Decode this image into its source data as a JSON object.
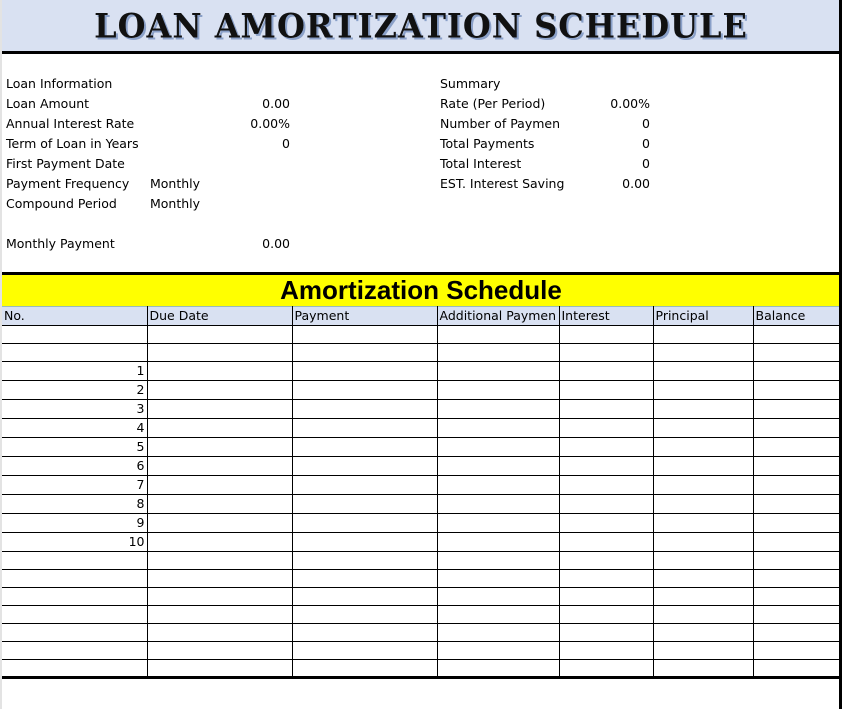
{
  "title": "LOAN AMORTIZATION SCHEDULE",
  "loan_information": {
    "heading": "Loan Information",
    "fields": [
      {
        "label": "Loan Amount",
        "value": "0.00",
        "align": "right"
      },
      {
        "label": "Annual Interest Rate",
        "value": "0.00%",
        "align": "right"
      },
      {
        "label": "Term of Loan in Years",
        "value": "0",
        "align": "right"
      },
      {
        "label": "First Payment Date",
        "value": "",
        "align": "right"
      },
      {
        "label": "Payment Frequency",
        "value": "Monthly",
        "align": "left"
      },
      {
        "label": "Compound Period",
        "value": "Monthly",
        "align": "left"
      }
    ],
    "monthly_payment": {
      "label": "Monthly Payment",
      "value": "0.00"
    }
  },
  "summary": {
    "heading": "Summary",
    "fields": [
      {
        "label": "Rate (Per Period)",
        "value": "0.00%"
      },
      {
        "label": "Number of Paymen",
        "value": "0"
      },
      {
        "label": "Total Payments",
        "value": "0"
      },
      {
        "label": "Total Interest",
        "value": "0"
      },
      {
        "label": "EST. Interest Saving",
        "value": "0.00"
      }
    ]
  },
  "schedule": {
    "title": "Amortization Schedule",
    "columns": [
      "No.",
      "Due Date",
      "Payment",
      "Additional Paymen",
      "Interest",
      "Principal",
      "Balance"
    ],
    "rows": [
      [
        "",
        "",
        "",
        "",
        "",
        "",
        ""
      ],
      [
        "",
        "",
        "",
        "",
        "",
        "",
        ""
      ],
      [
        "1",
        "",
        "",
        "",
        "",
        "",
        ""
      ],
      [
        "2",
        "",
        "",
        "",
        "",
        "",
        ""
      ],
      [
        "3",
        "",
        "",
        "",
        "",
        "",
        ""
      ],
      [
        "4",
        "",
        "",
        "",
        "",
        "",
        ""
      ],
      [
        "5",
        "",
        "",
        "",
        "",
        "",
        ""
      ],
      [
        "6",
        "",
        "",
        "",
        "",
        "",
        ""
      ],
      [
        "7",
        "",
        "",
        "",
        "",
        "",
        ""
      ],
      [
        "8",
        "",
        "",
        "",
        "",
        "",
        ""
      ],
      [
        "9",
        "",
        "",
        "",
        "",
        "",
        ""
      ],
      [
        "10",
        "",
        "",
        "",
        "",
        "",
        ""
      ],
      [
        "",
        "",
        "",
        "",
        "",
        "",
        ""
      ],
      [
        "",
        "",
        "",
        "",
        "",
        "",
        ""
      ],
      [
        "",
        "",
        "",
        "",
        "",
        "",
        ""
      ],
      [
        "",
        "",
        "",
        "",
        "",
        "",
        ""
      ],
      [
        "",
        "",
        "",
        "",
        "",
        "",
        ""
      ],
      [
        "",
        "",
        "",
        "",
        "",
        "",
        ""
      ],
      [
        "",
        "",
        "",
        "",
        "",
        "",
        ""
      ]
    ]
  },
  "colors": {
    "title_band": "#d9e1f2",
    "schedule_band": "#ffff00",
    "header_row": "#d9e1f2"
  }
}
